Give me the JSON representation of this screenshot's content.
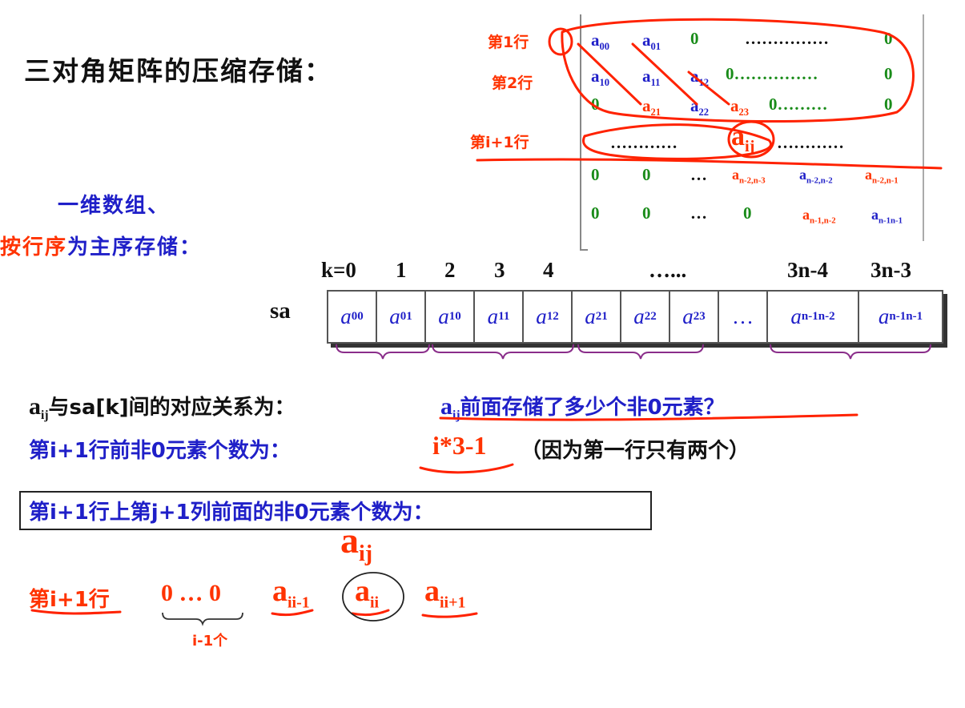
{
  "title": "三对角矩阵的压缩存储：",
  "row_labels": [
    "第1行",
    "第2行",
    "第i+1行"
  ],
  "matrix": {
    "row0": [
      "a",
      "00",
      "a",
      "01",
      "0",
      "……………",
      "0"
    ],
    "row1": [
      "a",
      "10",
      "a",
      "11",
      "a",
      "12",
      "0……………",
      "0"
    ],
    "row2": [
      "0",
      "a",
      "21",
      "a",
      "22",
      "a",
      "23",
      "0………",
      "0"
    ],
    "rowi": [
      "…………",
      "a",
      "ij",
      "…………"
    ],
    "rown2": [
      "0",
      "0",
      "…",
      "a",
      "n-2,n-3",
      "a",
      "n-2,n-2",
      "a",
      "n-2,n-1"
    ],
    "rown1": [
      "0",
      "0",
      "…",
      "0",
      "a",
      "n-1,n-2",
      "a",
      "n-1n-1"
    ]
  },
  "subtitle1": "一维数组、",
  "subtitle2_red": "按行序",
  "subtitle2_blue": "为主序存储：",
  "k_indices": [
    "k=0",
    "1",
    "2",
    "3",
    "4",
    "…...",
    "3n-4",
    "3n-3"
  ],
  "sa_label": "sa",
  "sa_cells": [
    {
      "base": "a",
      "sub": "00"
    },
    {
      "base": "a",
      "sub": "01"
    },
    {
      "base": "a",
      "sub": "10"
    },
    {
      "base": "a",
      "sub": "11"
    },
    {
      "base": "a",
      "sub": "12"
    },
    {
      "base": "a",
      "sub": "21"
    },
    {
      "base": "a",
      "sub": "22"
    },
    {
      "base": "a",
      "sub": "23"
    },
    {
      "base": "…",
      "sub": ""
    },
    {
      "base": "a",
      "sub": "n-1n-2"
    },
    {
      "base": "a",
      "sub": "n-1n-1"
    }
  ],
  "line1_a": "a",
  "line1_sub": "ij",
  "line1_text": "与sa[k]间的对应关系为：",
  "line1_q_a": "a",
  "line1_q_sub": "ij",
  "line1_q_text": "前面存储了多少个非0元素？",
  "line2_text": "第i+1行前非0元素个数为：",
  "line2_formula": "i*3-1",
  "line2_note": "（因为第一行只有两个）",
  "box_text": "第i+1行上第j+1列前面的非0元素个数为：",
  "aij_big_a": "a",
  "aij_big_sub": "ij",
  "bottom": {
    "label": "第i+1行",
    "zeros": "0 … 0",
    "brace_note": "i-1个",
    "t1_a": "a",
    "t1_sub": "ii-1",
    "t2_a": "a",
    "t2_sub": "ii",
    "t3_a": "a",
    "t3_sub": "ii+1"
  },
  "colors": {
    "red": "#ff3300",
    "blue": "#1f1fc8",
    "green": "#1a8c1a",
    "brace": "#8a2d8a"
  }
}
